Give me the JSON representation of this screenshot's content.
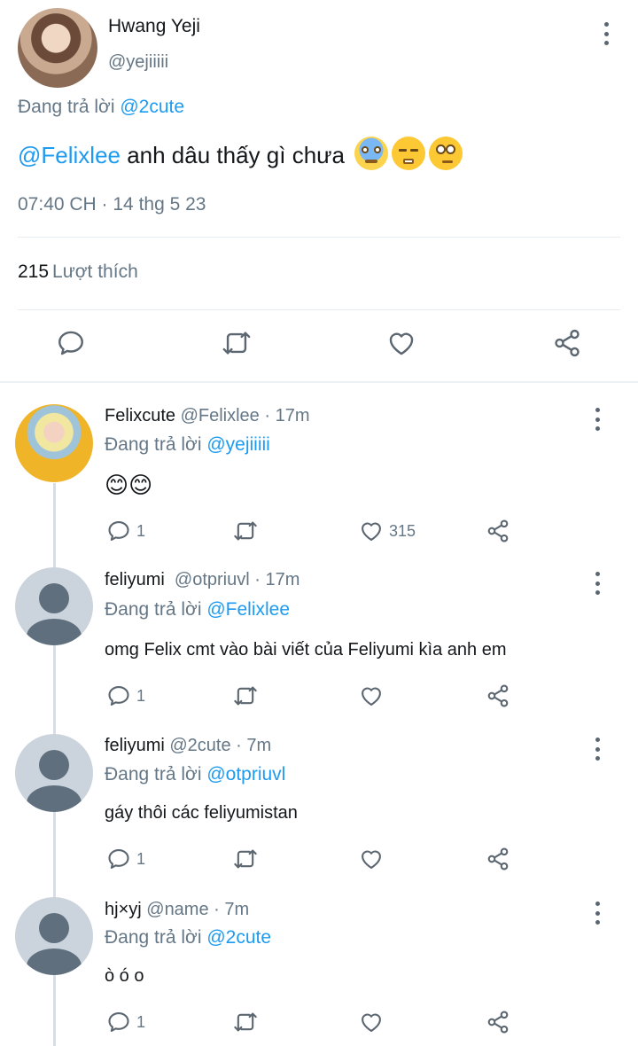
{
  "main_tweet": {
    "name": "Hwang Yeji",
    "handle": "@yejiiiii",
    "reply_prefix": "Đang trả lời",
    "reply_to": "@2cute",
    "mention": "@Felixlee",
    "text": " anh dâu thấy gì chưa",
    "emojis": [
      "scream-emoji",
      "triumph-emoji",
      "eye-roll-emoji"
    ],
    "timestamp": "07:40 CH · 14 thg 5 23",
    "likes_count": "215",
    "likes_label": "Lượt thích",
    "actions": [
      "reply-icon",
      "retweet-icon",
      "like-icon",
      "share-icon"
    ]
  },
  "replies": [
    {
      "name": "Felixcute",
      "meta": " @Felixlee · 17m",
      "reply_prefix": "Đang trả lời",
      "reply_to": "@yejiiiii",
      "text": "😊😊",
      "reply_count": "1",
      "like_count": "315"
    },
    {
      "name": "feliyumi",
      "meta": "  @otpriuvl · 17m",
      "reply_prefix": "Đang trả lời",
      "reply_to": "@Felixlee",
      "text": "omg Felix cmt vào bài viết của Feliyumi kìa anh em",
      "reply_count": "1",
      "like_count": ""
    },
    {
      "name": "feliyumi",
      "meta": " @2cute · 7m",
      "reply_prefix": "Đang trả lời",
      "reply_to": "@otpriuvl",
      "text": "gáy thôi các feliyumistan",
      "reply_count": "1",
      "like_count": ""
    },
    {
      "name": "hj×yj",
      "meta": " @name · 7m",
      "reply_prefix": "Đang trả lời",
      "reply_to": "@2cute",
      "text": "ò ó o",
      "reply_count": "1",
      "like_count": ""
    }
  ],
  "colors": {
    "accent": "#1d9bf0",
    "muted": "#657786",
    "text": "#14171a",
    "icon": "#5b6670"
  }
}
